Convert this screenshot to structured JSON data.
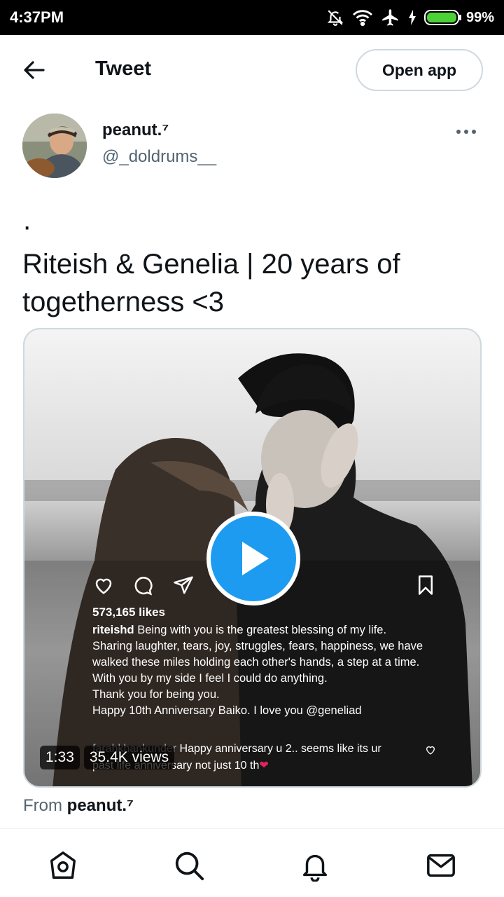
{
  "status_bar": {
    "time": "4:37PM",
    "battery_percent": "99%",
    "battery_level": 0.99,
    "icons": [
      "notifications-off-icon",
      "wifi-icon",
      "airplane-mode-icon",
      "charging-icon",
      "battery-icon"
    ]
  },
  "header": {
    "title": "Tweet",
    "back_icon": "arrow-left-icon",
    "open_app_label": "Open app"
  },
  "tweet": {
    "author_name": "peanut.⁷",
    "author_handle": "@_doldrums__",
    "more_icon": "more-horizontal-icon",
    "text": "·\nRiteish & Genelia | 20 years of togetherness <3",
    "media": {
      "type": "video",
      "duration": "1:33",
      "views": "35.4K views",
      "embedded_post": {
        "likes": "573,165 likes",
        "caption_user": "riteishd",
        "caption_lines": [
          "Being with you is the greatest blessing of my life.",
          "Sharing laughter, tears, joy, struggles, fears, happiness, we have walked these miles holding each other's hands, a step at a time.",
          "With you by my side I feel I could do anything.",
          "Thank you for being you.",
          "Happy 10th Anniversary Baiko. I love you @geneliad"
        ],
        "comment_user": "farahkhankunder",
        "comment_text": "Happy anniversary u 2.. seems like its ur",
        "comment_line2": "past life anniversary not just 10 th",
        "comment_emoji": "❤"
      }
    },
    "from_prefix": "From",
    "from_name": "peanut.⁷"
  },
  "bottom_nav": {
    "items": [
      "home-icon",
      "search-icon",
      "notifications-icon",
      "messages-icon"
    ]
  },
  "colors": {
    "accent": "#1d9bf0",
    "text_primary": "#0f1419",
    "text_secondary": "#536471",
    "border": "#cfd9de"
  }
}
